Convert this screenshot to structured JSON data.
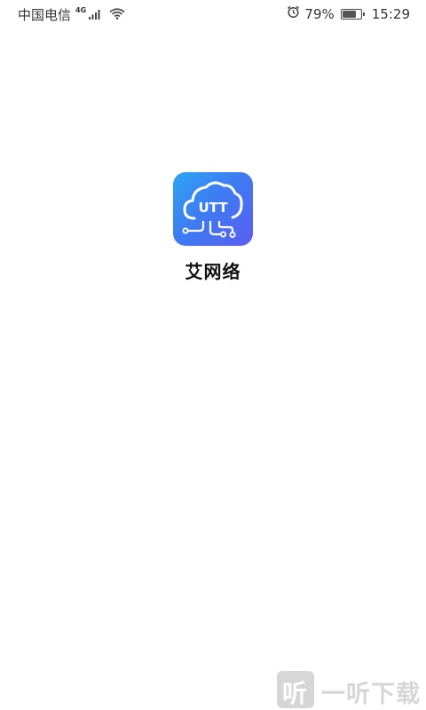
{
  "status_bar": {
    "carrier": "中国电信",
    "network_type": "4G",
    "battery_percent": "79%",
    "battery_level": 0.79,
    "time": "15:29",
    "icons": [
      "signal-icon",
      "wifi-icon",
      "alarm-icon",
      "battery-icon"
    ]
  },
  "app": {
    "logo_text": "UTT",
    "name": "艾网络",
    "logo_gradient": [
      "#2ea6f4",
      "#3d7cf2",
      "#5a5ef0"
    ]
  },
  "watermark": {
    "text": "一听下载",
    "glyph": "听"
  }
}
